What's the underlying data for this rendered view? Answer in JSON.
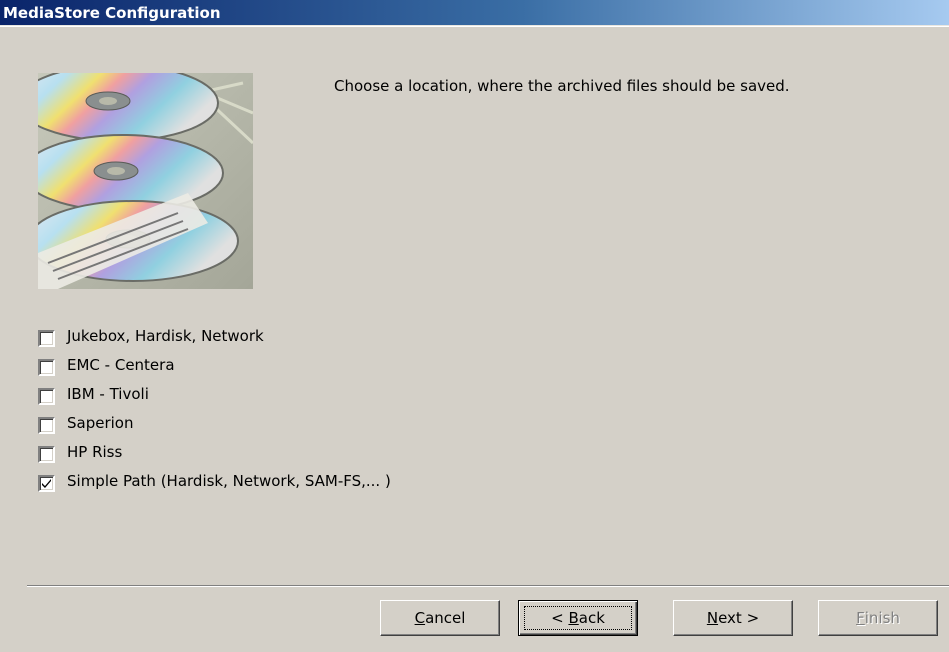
{
  "window": {
    "title": "MediaStore Configuration"
  },
  "instruction": "Choose a location, where the archived files should be saved.",
  "options": [
    {
      "label": "Jukebox, Hardisk, Network",
      "checked": false
    },
    {
      "label": "EMC - Centera",
      "checked": false
    },
    {
      "label": "IBM - Tivoli",
      "checked": false
    },
    {
      "label": "Saperion",
      "checked": false
    },
    {
      "label": "HP Riss",
      "checked": false
    },
    {
      "label": "Simple Path (Hardisk, Network, SAM-FS,... )",
      "checked": true
    }
  ],
  "buttons": {
    "cancel": {
      "mnemonic": "C",
      "rest": "ancel"
    },
    "back": {
      "pre": "< ",
      "mnemonic": "B",
      "rest": "ack"
    },
    "next": {
      "mnemonic": "N",
      "rest": "ext >"
    },
    "finish": {
      "mnemonic": "F",
      "rest": "inish",
      "disabled": true
    }
  }
}
